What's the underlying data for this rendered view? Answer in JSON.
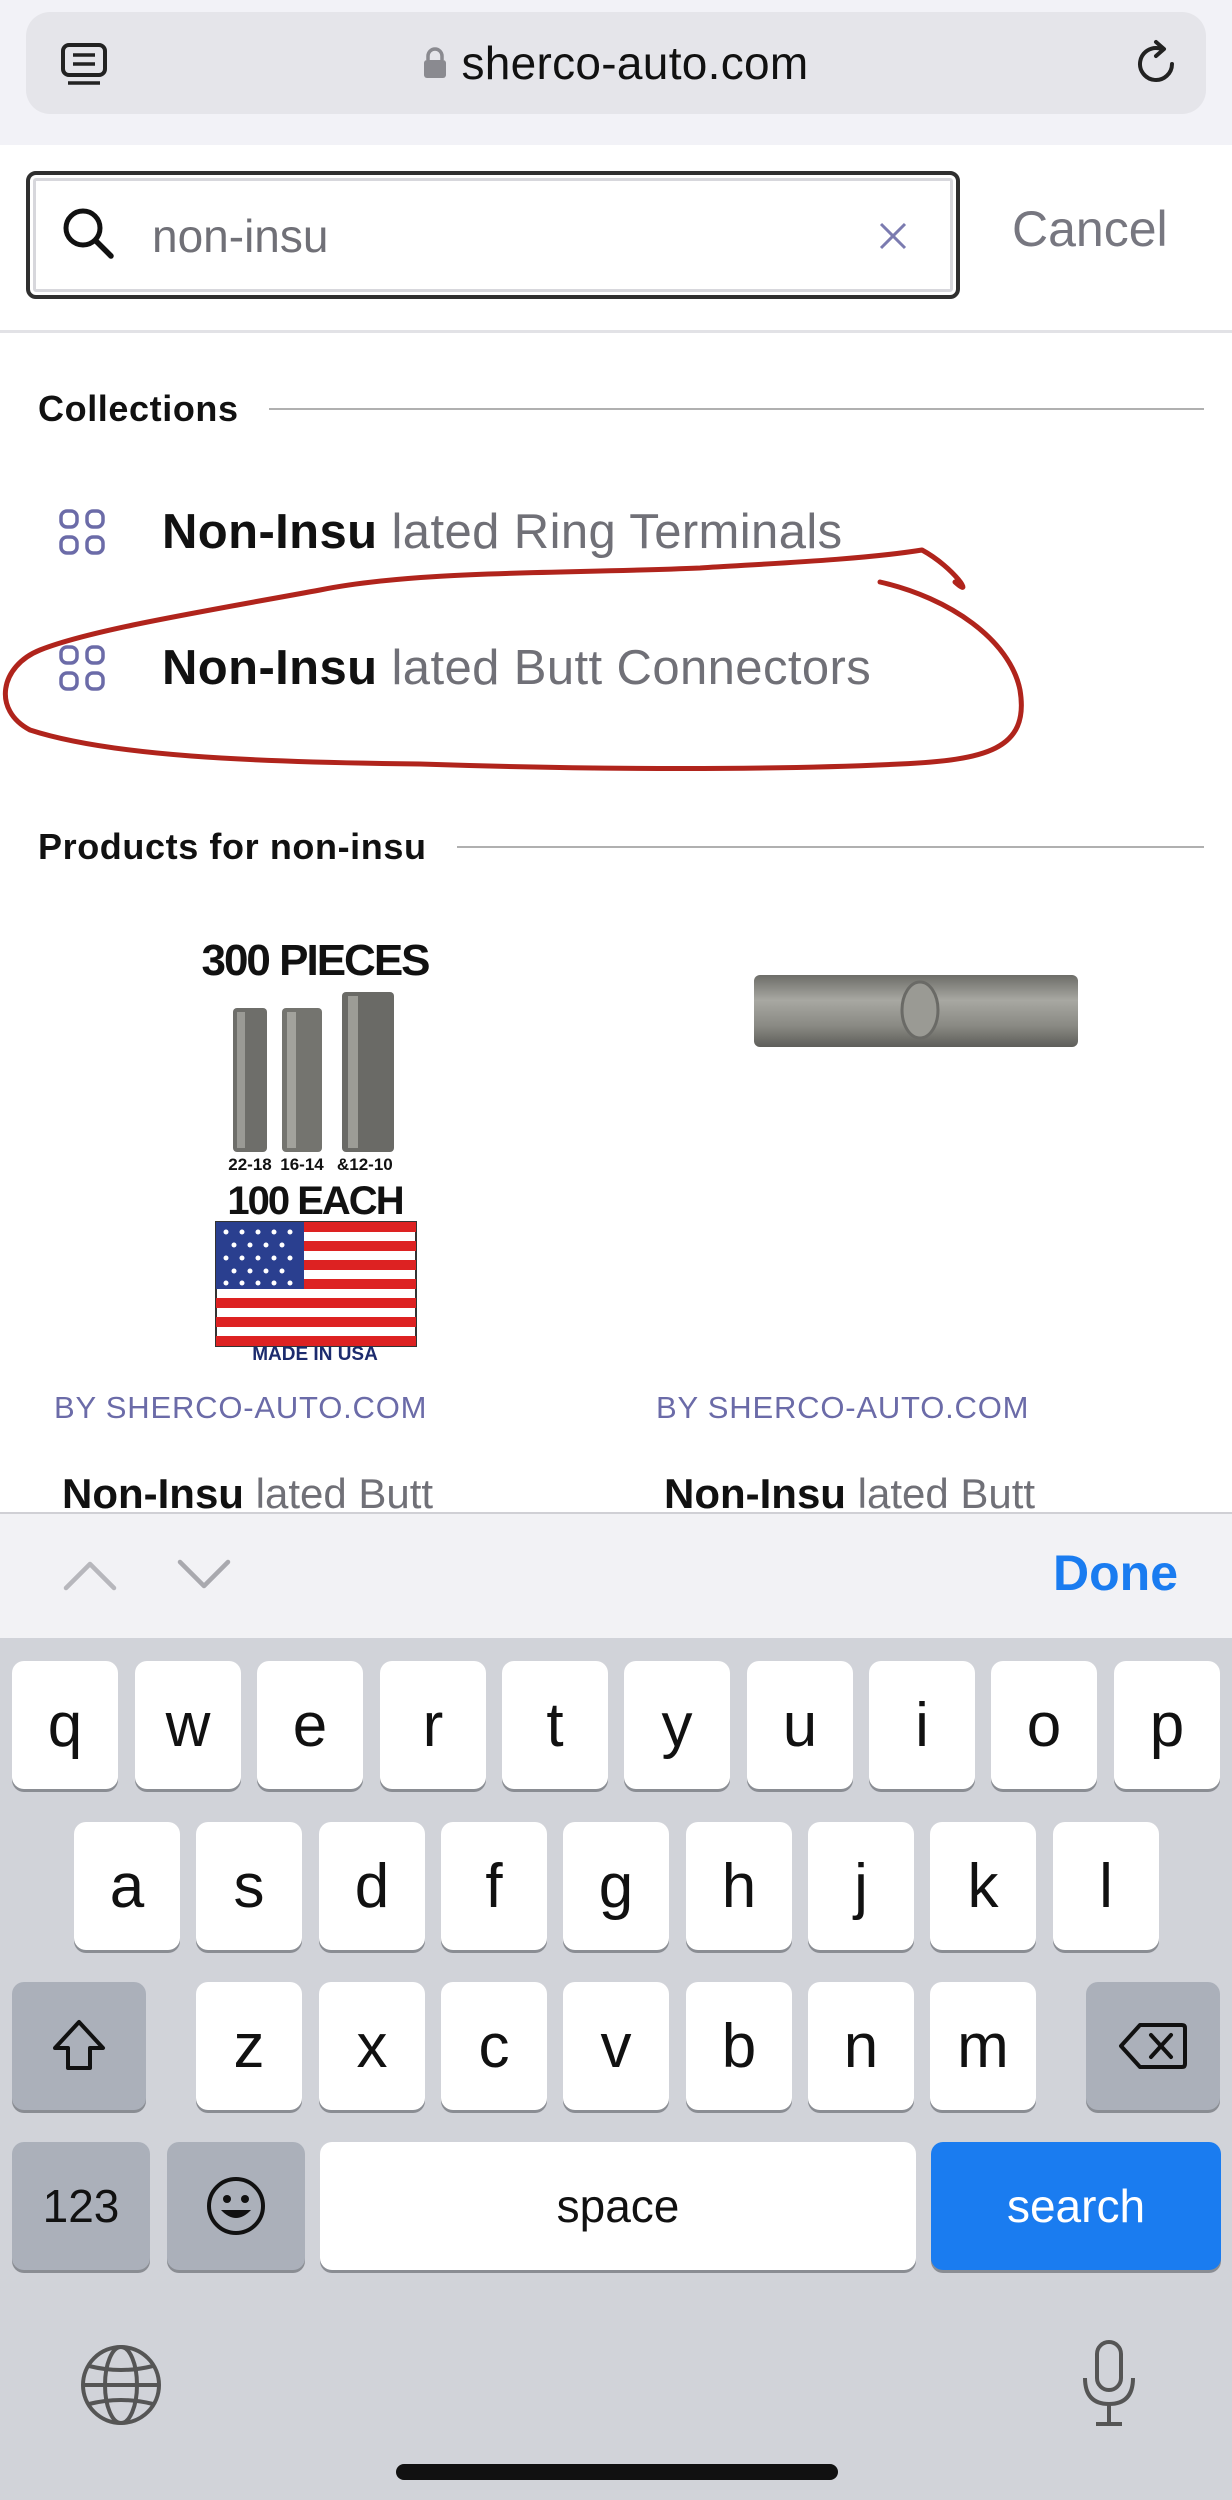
{
  "browser": {
    "url": "sherco-auto.com",
    "icons": {
      "tabs": "tabs-icon",
      "lock": "lock-icon",
      "reload": "reload-icon"
    }
  },
  "search": {
    "value": "non-insu",
    "placeholder": "",
    "cancel_label": "Cancel",
    "icons": {
      "search": "search-icon",
      "clear": "clear-icon"
    }
  },
  "collections": {
    "heading": "Collections",
    "items": [
      {
        "match": "Non-Insu",
        "rest": "lated Ring Terminals",
        "icon": "grid-icon"
      },
      {
        "match": "Non-Insu",
        "rest": "lated Butt Connectors",
        "icon": "grid-icon"
      }
    ],
    "annotation_color": "#b0241c"
  },
  "products": {
    "heading": "Products for non-insu",
    "items": [
      {
        "vendor": "BY SHERCO-AUTO.COM",
        "name_match": "Non-Insu",
        "name_rest": "lated Butt",
        "image_text": {
          "top": "300 PIECES",
          "sizes": [
            "22-18",
            "16-14",
            "&",
            "12-10"
          ],
          "middle": "100 EACH",
          "bottom": "MADE IN USA"
        }
      },
      {
        "vendor": "BY SHERCO-AUTO.COM",
        "name_match": "Non-Insu",
        "name_rest": "lated Butt"
      }
    ]
  },
  "accessory": {
    "done_label": "Done",
    "icons": {
      "prev": "chevron-up-icon",
      "next": "chevron-down-icon"
    }
  },
  "keyboard": {
    "row1": [
      "q",
      "w",
      "e",
      "r",
      "t",
      "y",
      "u",
      "i",
      "o",
      "p"
    ],
    "row2": [
      "a",
      "s",
      "d",
      "f",
      "g",
      "h",
      "j",
      "k",
      "l"
    ],
    "row3": [
      "z",
      "x",
      "c",
      "v",
      "b",
      "n",
      "m"
    ],
    "numbers_label": "123",
    "space_label": "space",
    "search_label": "search",
    "colors": {
      "background": "#d1d3d9",
      "key": "#ffffff",
      "special_key": "#abb0ba",
      "action": "#1a7cf0"
    }
  }
}
